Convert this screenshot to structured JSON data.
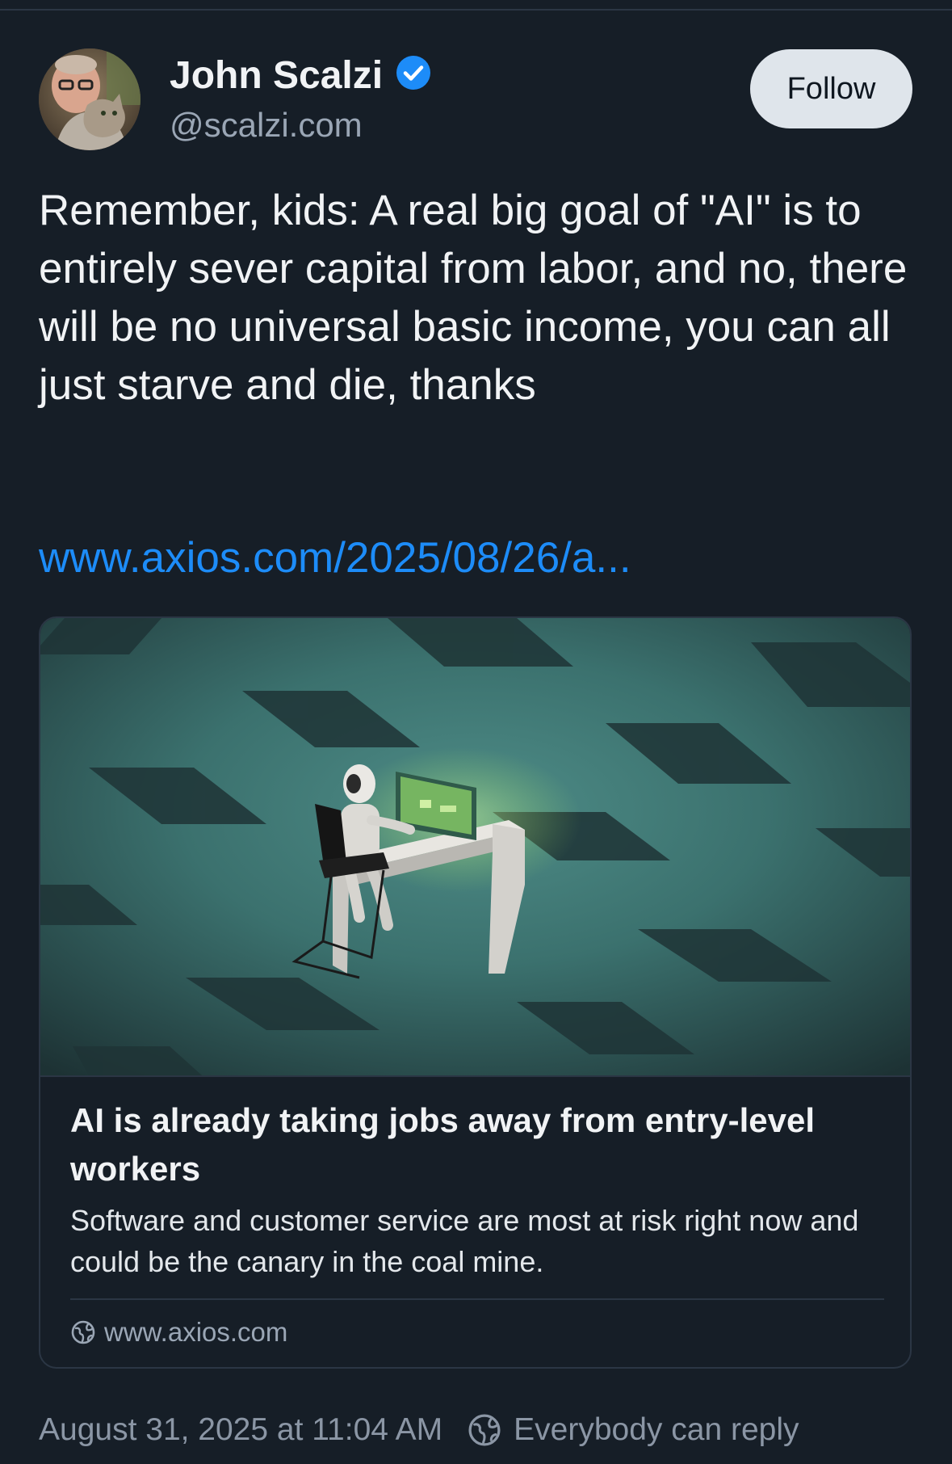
{
  "author": {
    "display_name": "John Scalzi",
    "handle": "@scalzi.com",
    "verified": true
  },
  "actions": {
    "follow_label": "Follow"
  },
  "post": {
    "text": "Remember, kids: A real big goal of \"AI\" is to entirely sever capital from labor, and no, there will be no universal basic income, you can all just starve and die, thanks",
    "link_text": "www.axios.com/2025/08/26/a..."
  },
  "link_card": {
    "title": "AI is already taking jobs away from entry-level workers",
    "description": "Software and customer service are most at risk right now and could be the canary in the coal mine.",
    "domain": "www.axios.com"
  },
  "footer": {
    "timestamp": "August 31, 2025 at 11:04 AM",
    "reply_setting": "Everybody can reply"
  },
  "icons": {
    "verified": "verified-check-icon",
    "globe": "globe-icon"
  },
  "colors": {
    "background": "#161e27",
    "accent_link": "#1d8cf8",
    "follow_button_bg": "#dfe5eb",
    "muted_text": "#9aa6b5",
    "verified_badge": "#1d8cf8"
  }
}
